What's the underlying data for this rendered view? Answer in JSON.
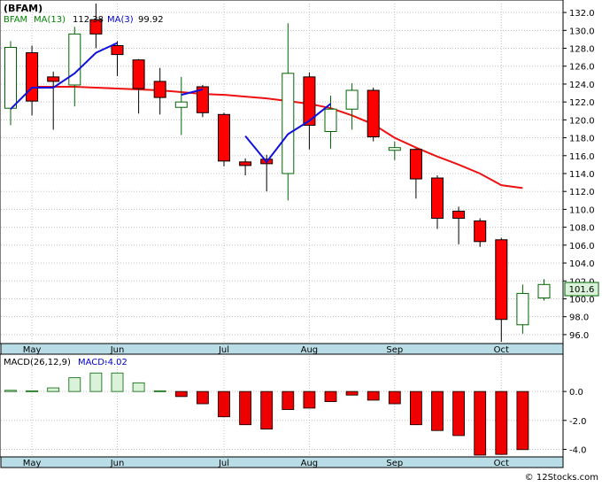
{
  "title": "(BFAM)",
  "footer": "© 12Stocks.com",
  "colors": {
    "background": "#ffffff",
    "frame": "#000000",
    "grid": "#c0c0c0",
    "axis_band": "#b9dde6",
    "up": "#ffffff",
    "up_stroke": "#006400",
    "down": "#ff0000",
    "down_stroke": "#000000",
    "ma13": "#ee1111",
    "ma3": "#1111dd",
    "macd_pos": "#d9f2d9",
    "macd_neg": "#ee0000",
    "price_tag_bg": "#d9f2d9"
  },
  "chart_data": [
    {
      "type": "candlestick",
      "legend": {
        "symbol": "BFAM",
        "ma13_label": "MA(13)",
        "ma13_value": "112.38",
        "ma3_label": "MA(3)",
        "ma3_value": "99.92"
      },
      "last_price_label": "101.6",
      "x_labels": [
        {
          "label": "May",
          "index": 1
        },
        {
          "label": "Jun",
          "index": 5
        },
        {
          "label": "Jul",
          "index": 10
        },
        {
          "label": "Aug",
          "index": 14
        },
        {
          "label": "Sep",
          "index": 18
        },
        {
          "label": "Oct",
          "index": 23
        }
      ],
      "ylim": [
        95,
        133
      ],
      "yticks": [
        96,
        98,
        100,
        102,
        104,
        106,
        108,
        110,
        112,
        114,
        116,
        118,
        120,
        122,
        124,
        126,
        128,
        130,
        132
      ],
      "ytick_labels": [
        "96.0",
        "98.0",
        "100.0",
        "102.0",
        "104.0",
        "106.0",
        "108.0",
        "110.0",
        "112.0",
        "114.0",
        "116.0",
        "118.0",
        "120.0",
        "122.0",
        "124.0",
        "126.0",
        "128.0",
        "130.0",
        "132.0"
      ],
      "candles": [
        {
          "o": 121.3,
          "h": 128.8,
          "l": 119.4,
          "c": 128.1
        },
        {
          "o": 127.5,
          "h": 128.3,
          "l": 120.5,
          "c": 122.1
        },
        {
          "o": 124.8,
          "h": 125.4,
          "l": 118.9,
          "c": 124.3
        },
        {
          "o": 123.9,
          "h": 130.4,
          "l": 121.5,
          "c": 129.6
        },
        {
          "o": 131.2,
          "h": 133.0,
          "l": 128.0,
          "c": 129.6
        },
        {
          "o": 128.3,
          "h": 128.8,
          "l": 124.9,
          "c": 127.3
        },
        {
          "o": 126.7,
          "h": 126.8,
          "l": 120.7,
          "c": 123.5
        },
        {
          "o": 124.3,
          "h": 125.8,
          "l": 120.6,
          "c": 122.5
        },
        {
          "o": 121.4,
          "h": 124.8,
          "l": 118.3,
          "c": 122.0
        },
        {
          "o": 123.7,
          "h": 123.9,
          "l": 120.3,
          "c": 120.8
        },
        {
          "o": 120.6,
          "h": 120.8,
          "l": 114.8,
          "c": 115.4
        },
        {
          "o": 115.3,
          "h": 115.7,
          "l": 113.8,
          "c": 114.9
        },
        {
          "o": 115.6,
          "h": 116.1,
          "l": 112.0,
          "c": 115.1
        },
        {
          "o": 114.0,
          "h": 130.8,
          "l": 111.0,
          "c": 125.2
        },
        {
          "o": 124.8,
          "h": 125.3,
          "l": 116.7,
          "c": 119.4
        },
        {
          "o": 118.7,
          "h": 122.7,
          "l": 116.8,
          "c": 121.2
        },
        {
          "o": 121.2,
          "h": 124.1,
          "l": 118.9,
          "c": 123.3
        },
        {
          "o": 123.3,
          "h": 123.6,
          "l": 117.6,
          "c": 118.1
        },
        {
          "o": 116.6,
          "h": 117.6,
          "l": 115.5,
          "c": 116.9
        },
        {
          "o": 116.7,
          "h": 116.8,
          "l": 111.2,
          "c": 113.4
        },
        {
          "o": 113.5,
          "h": 113.8,
          "l": 107.8,
          "c": 109.0
        },
        {
          "o": 109.8,
          "h": 110.3,
          "l": 106.1,
          "c": 109.0
        },
        {
          "o": 108.7,
          "h": 109.0,
          "l": 105.8,
          "c": 106.4
        },
        {
          "o": 106.6,
          "h": 106.8,
          "l": 95.2,
          "c": 97.7
        },
        {
          "o": 97.1,
          "h": 101.6,
          "l": 96.1,
          "c": 100.6
        },
        {
          "o": 100.1,
          "h": 102.2,
          "l": 99.8,
          "c": 101.6
        }
      ],
      "ma13": [
        null,
        123.7,
        123.7,
        123.7,
        123.6,
        123.5,
        123.4,
        123.3,
        123.1,
        122.9,
        122.8,
        122.6,
        122.4,
        122.1,
        121.8,
        121.3,
        120.5,
        119.5,
        118.0,
        116.9,
        115.9,
        115.0,
        114.0,
        112.7,
        112.38
      ],
      "ma3": [
        121.2,
        123.6,
        123.6,
        125.2,
        127.5,
        128.6,
        null,
        null,
        122.8,
        123.4,
        null,
        118.2,
        115.3,
        118.4,
        119.9,
        121.8
      ]
    },
    {
      "type": "bar",
      "title": "MACD(26,12,9)",
      "legend_label": "MACD:",
      "legend_value": "-4.02",
      "ylim": [
        -4.4,
        1.6
      ],
      "yticks": [
        0.0,
        -2.0,
        -4.0
      ],
      "ytick_labels": [
        "0.0",
        "-2.0",
        "-4.0"
      ],
      "x_labels": [
        {
          "label": "May",
          "index": 1
        },
        {
          "label": "Jun",
          "index": 5
        },
        {
          "label": "Jul",
          "index": 10
        },
        {
          "label": "Aug",
          "index": 14
        },
        {
          "label": "Sep",
          "index": 18
        },
        {
          "label": "Oct",
          "index": 23
        }
      ],
      "values": [
        0.08,
        0.05,
        0.25,
        0.95,
        1.28,
        1.28,
        0.6,
        0.05,
        -0.35,
        -0.85,
        -1.75,
        -2.3,
        -2.6,
        -1.25,
        -1.15,
        -0.7,
        -0.25,
        -0.6,
        -0.85,
        -2.3,
        -2.7,
        -3.05,
        -4.4,
        -4.35,
        -4.02
      ]
    }
  ]
}
